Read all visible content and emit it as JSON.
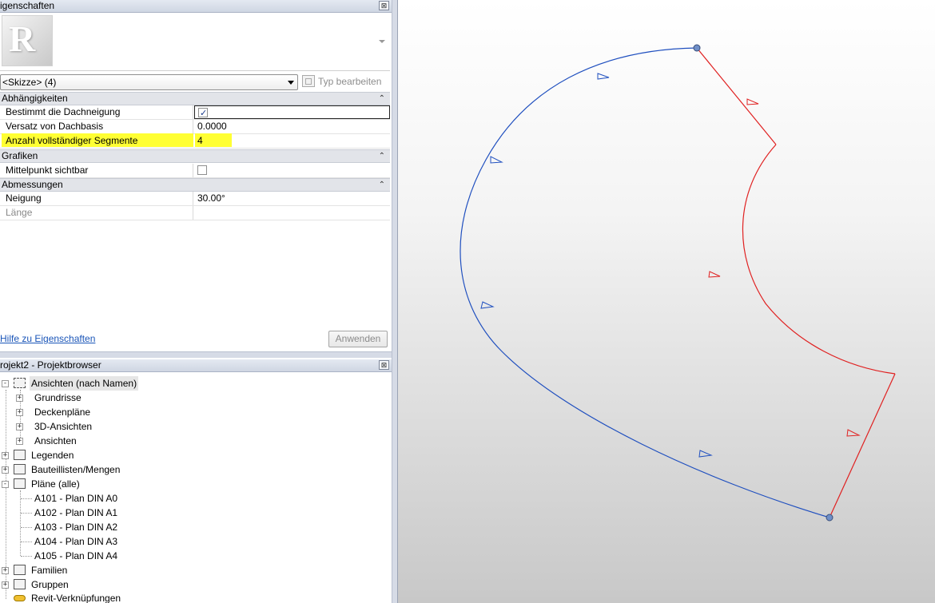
{
  "properties": {
    "title": "igenschaften",
    "close_label": "⊠",
    "type_selector": "<Skizze> (4)",
    "edit_type_label": "Typ bearbeiten",
    "groups": [
      {
        "label": "Abhängigkeiten",
        "collapse": "⌃"
      },
      {
        "label": "Grafiken",
        "collapse": "⌃"
      },
      {
        "label": "Abmessungen",
        "collapse": "⌃"
      }
    ],
    "rows": {
      "slope_defining": {
        "name": "Bestimmt die Dachneigung",
        "checked": true
      },
      "base_offset": {
        "name": "Versatz von Dachbasis",
        "value": "0.0000"
      },
      "full_segments": {
        "name": "Anzahl vollständiger Segmente",
        "value": "4"
      },
      "center_visible": {
        "name": "Mittelpunkt sichtbar",
        "checked": false
      },
      "slope": {
        "name": "Neigung",
        "value": "30.00°"
      },
      "length": {
        "name": "Länge",
        "value": ""
      }
    },
    "help_link": "Hilfe zu Eigenschaften",
    "apply_label": "Anwenden",
    "highlight_color": "#ffff33"
  },
  "browser": {
    "title": "rojekt2 - Projektbrowser",
    "close_label": "⊠",
    "items": [
      {
        "label": "Ansichten (nach Namen)",
        "icon": "views-icon"
      },
      {
        "label": "Grundrisse"
      },
      {
        "label": "Deckenpläne"
      },
      {
        "label": "3D-Ansichten"
      },
      {
        "label": "Ansichten"
      },
      {
        "label": "Legenden",
        "icon": "legend-icon"
      },
      {
        "label": "Bauteillisten/Mengen",
        "icon": "schedule-icon"
      },
      {
        "label": "Pläne (alle)",
        "icon": "sheets-icon"
      },
      {
        "label": "A101 - Plan DIN A0"
      },
      {
        "label": "A102 - Plan DIN A1"
      },
      {
        "label": "A103 - Plan DIN A2"
      },
      {
        "label": "A104 - Plan DIN A3"
      },
      {
        "label": "A105 - Plan DIN A4"
      },
      {
        "label": "Familien",
        "icon": "families-icon"
      },
      {
        "label": "Gruppen",
        "icon": "groups-icon"
      },
      {
        "label": "Revit-Verknüpfungen",
        "icon": "links-icon"
      }
    ]
  },
  "sketch": {
    "blue_color": "#1f4fbf",
    "red_color": "#e02020",
    "endpoint_color": "#6f8fc8"
  }
}
